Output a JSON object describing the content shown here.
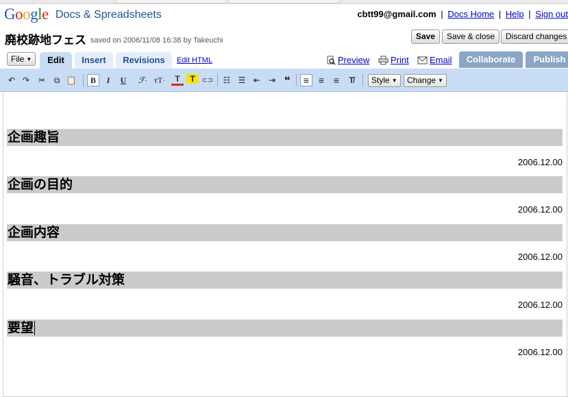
{
  "header": {
    "logo": {
      "G": "G",
      "o1": "o",
      "o2": "o",
      "g": "g",
      "l": "l",
      "e": "e"
    },
    "product": "Docs & Spreadsheets",
    "email": "cbtt99@gmail.com",
    "links": {
      "docs_home": "Docs Home",
      "help": "Help",
      "sign_out": "Sign out"
    },
    "separator": "|"
  },
  "document": {
    "title": "廃校跡地フェス",
    "meta": "saved on 2006/11/08 16:38 by Takeuchi"
  },
  "actions": {
    "save": "Save",
    "save_close": "Save & close",
    "discard": "Discard changes"
  },
  "menu": {
    "file": "File"
  },
  "tabs": [
    {
      "label": "Edit"
    },
    {
      "label": "Insert"
    },
    {
      "label": "Revisions"
    }
  ],
  "edit_html": "Edit HTML",
  "links": {
    "preview": "Preview",
    "print": "Print",
    "email": "Email"
  },
  "blue_tabs": {
    "collaborate": "Collaborate",
    "publish": "Publish"
  },
  "toolbar": {
    "style_label": "Style",
    "change_label": "Change",
    "glyphs": {
      "undo": "↶",
      "redo": "↷",
      "cut": "✂",
      "copy": "⧉",
      "paste": "📋",
      "bold": "B",
      "italic": "I",
      "underline": "U",
      "font": "ℱ·",
      "size": "ᴛT·",
      "text_color": "T",
      "highlight": "T",
      "link": "⊂⊃",
      "numbered_list": "☷",
      "bullet_list": "☰",
      "outdent": "⇤",
      "indent": "⇥",
      "quote": "❝",
      "align_left": "≡",
      "align_center": "≡",
      "align_right": "≡",
      "clear_format": "T̸"
    }
  },
  "sections": [
    {
      "heading": "企画趣旨",
      "date": "2006.12.00"
    },
    {
      "heading": "企画の目的",
      "date": "2006.12.00"
    },
    {
      "heading": "企画内容",
      "date": "2006.12.00"
    },
    {
      "heading": "騒音、トラブル対策",
      "date": "2006.12.00"
    },
    {
      "heading": "要望",
      "date": "2006.12.00"
    }
  ],
  "colors": {
    "toolbar_bg": "#c9dcf6",
    "tab_active": "#c9dcf6",
    "tab_inactive": "#e4eefb",
    "collab_tab": "#8ba6c6",
    "heading_bg": "#cbcbcb",
    "link": "#0000cc"
  }
}
